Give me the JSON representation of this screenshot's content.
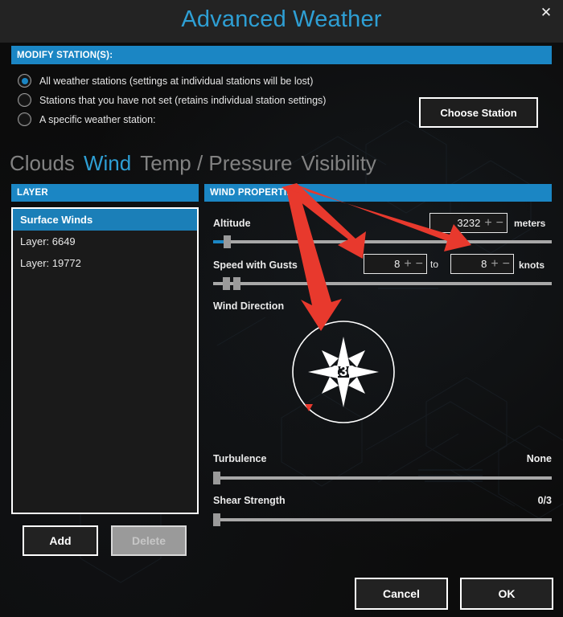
{
  "window": {
    "title": "Advanced Weather",
    "close_icon": "close-icon"
  },
  "modify": {
    "header": "MODIFY STATION(S):",
    "options": [
      {
        "label": "All weather stations (settings at individual stations will be lost)",
        "selected": true
      },
      {
        "label": "Stations that you have not set (retains individual station settings)",
        "selected": false
      },
      {
        "label": "A specific weather station:",
        "selected": false
      }
    ],
    "choose_station_label": "Choose Station"
  },
  "tabs": [
    {
      "label": "Clouds",
      "active": false
    },
    {
      "label": "Wind",
      "active": true
    },
    {
      "label": "Temp / Pressure",
      "active": false
    },
    {
      "label": "Visibility",
      "active": false
    }
  ],
  "layer_panel": {
    "header": "LAYER",
    "items": [
      {
        "label": "Surface Winds",
        "selected": true
      },
      {
        "label": "Layer: 6649",
        "selected": false
      },
      {
        "label": "Layer: 19772",
        "selected": false
      }
    ],
    "add_label": "Add",
    "delete_label": "Delete"
  },
  "wind_panel": {
    "header": "WIND PROPERTIES",
    "altitude": {
      "label": "Altitude",
      "value": "3232",
      "unit": "meters",
      "plus": "+",
      "minus": "−",
      "slider_percent": 4
    },
    "speed": {
      "label": "Speed with Gusts",
      "value_min": "8",
      "value_max": "8",
      "to_label": "to",
      "unit": "knots",
      "plus": "+",
      "minus": "−",
      "slider_min_percent": 3,
      "slider_max_percent": 7
    },
    "direction": {
      "label": "Wind Direction",
      "value": "230"
    },
    "turbulence": {
      "label": "Turbulence",
      "value": "None",
      "slider_percent": 0
    },
    "shear": {
      "label": "Shear Strength",
      "value": "0/3",
      "slider_percent": 0
    }
  },
  "footer": {
    "cancel_label": "Cancel",
    "ok_label": "OK"
  },
  "colors": {
    "accent_blue": "#1b86c4",
    "title_blue": "#2e9fd4",
    "annotation_red": "#e8392d",
    "panel_bg": "#1a1a1a"
  }
}
